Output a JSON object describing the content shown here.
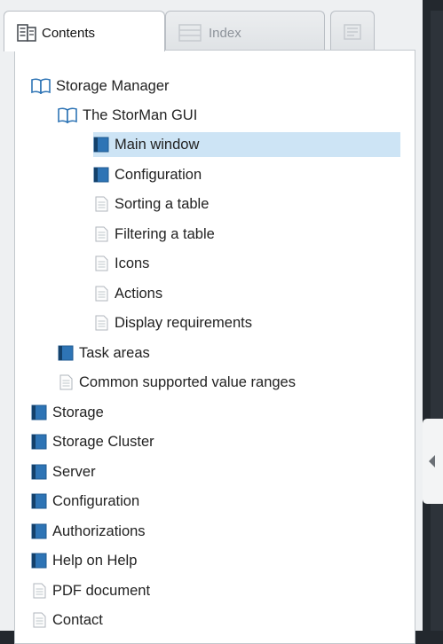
{
  "tabs": {
    "contents_label": "Contents",
    "index_label": "Index",
    "third_label": ""
  },
  "tree": [
    {
      "label": "Storage Manager",
      "icon": "book-open-icon",
      "level": 0
    },
    {
      "label": "The StorMan GUI",
      "icon": "book-open-icon",
      "level": 1
    },
    {
      "label": "Main window",
      "icon": "book-closed-icon",
      "level": 2,
      "selected": true
    },
    {
      "label": "Configuration",
      "icon": "book-closed-icon",
      "level": 2
    },
    {
      "label": "Sorting a table",
      "icon": "page-icon",
      "level": 2
    },
    {
      "label": "Filtering a table",
      "icon": "page-icon",
      "level": 2
    },
    {
      "label": "Icons",
      "icon": "page-icon",
      "level": 2
    },
    {
      "label": "Actions",
      "icon": "page-icon",
      "level": 2
    },
    {
      "label": "Display requirements",
      "icon": "page-icon",
      "level": 2
    },
    {
      "label": "Task areas",
      "icon": "book-closed-icon",
      "level": 1
    },
    {
      "label": "Common supported value ranges",
      "icon": "page-icon",
      "level": 1
    },
    {
      "label": "Storage",
      "icon": "book-closed-icon",
      "level": 0
    },
    {
      "label": "Storage Cluster",
      "icon": "book-closed-icon",
      "level": 0
    },
    {
      "label": "Server",
      "icon": "book-closed-icon",
      "level": 0
    },
    {
      "label": "Configuration",
      "icon": "book-closed-icon",
      "level": 0
    },
    {
      "label": "Authorizations",
      "icon": "book-closed-icon",
      "level": 0
    },
    {
      "label": "Help on Help",
      "icon": "book-closed-icon",
      "level": 0
    },
    {
      "label": "PDF document",
      "icon": "page-icon",
      "level": 0
    },
    {
      "label": "Contact",
      "icon": "page-icon",
      "level": 0
    }
  ],
  "colors": {
    "selection": "#cde4f5",
    "book": "#2e74b5"
  }
}
